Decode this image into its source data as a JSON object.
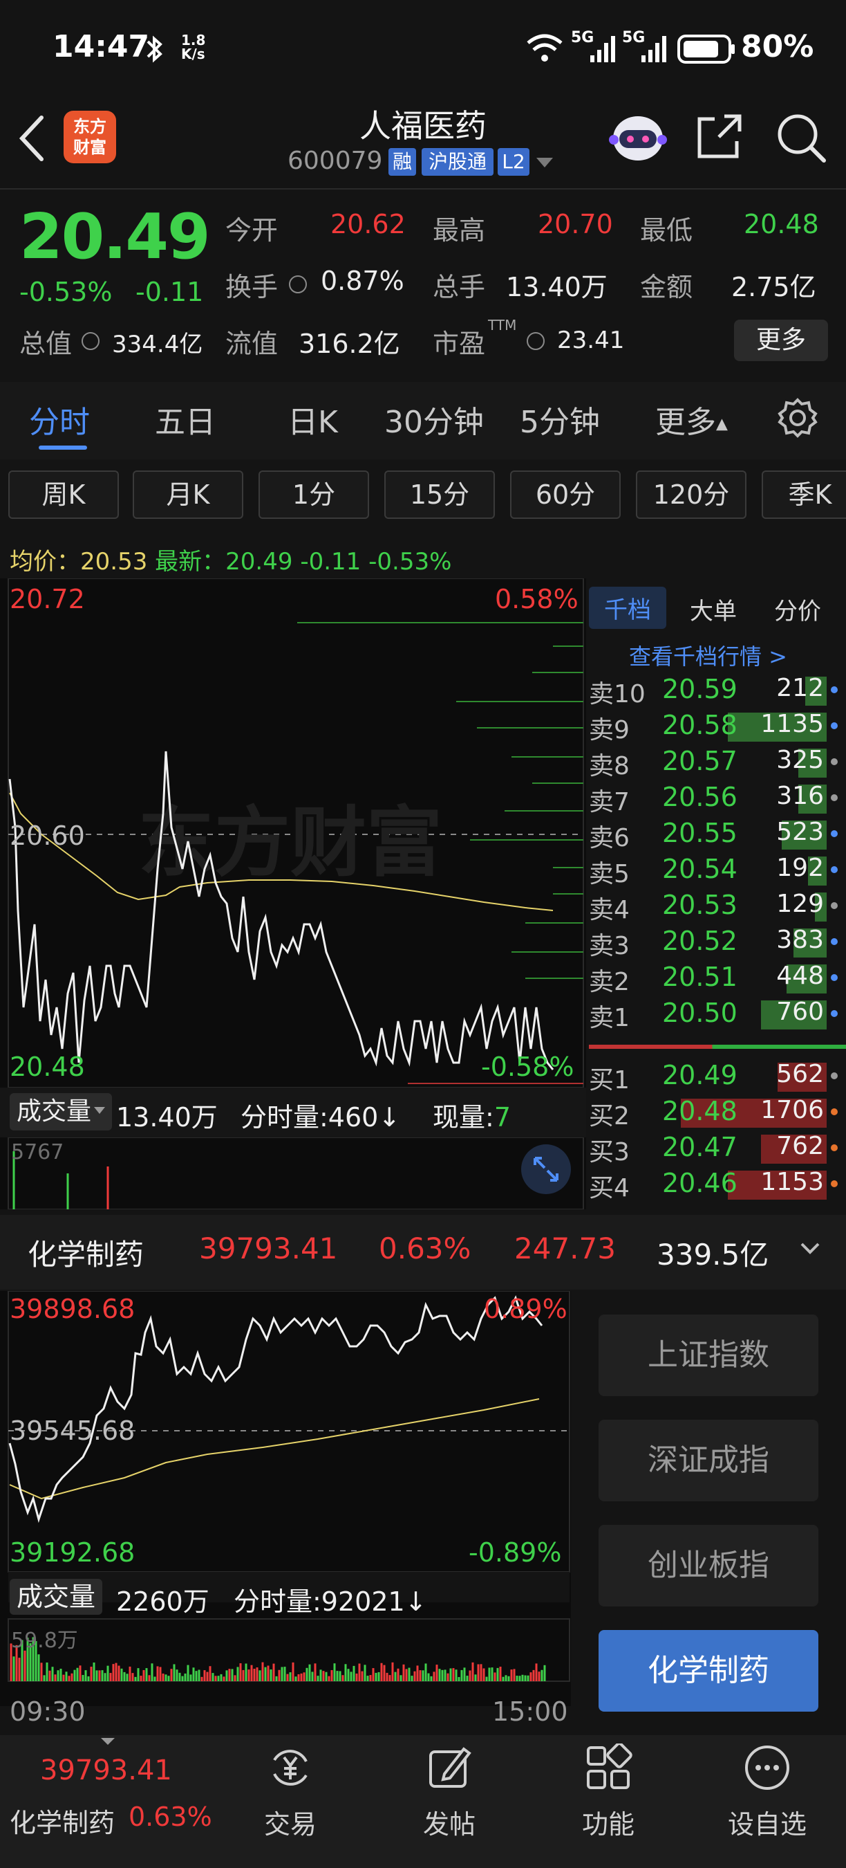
{
  "status_bar": {
    "time": "14:47",
    "speed_value": "1.8",
    "speed_unit": "K/s",
    "network_label": "5G",
    "battery": "80%"
  },
  "header": {
    "brand_line1": "东方",
    "brand_line2": "财富",
    "stock_name": "人福医药",
    "stock_code": "600079",
    "tag_rong": "融",
    "tag_hgt": "沪股通",
    "tag_l2": "L2"
  },
  "quote": {
    "price": "20.49",
    "change_pct": "-0.53%",
    "change": "-0.11",
    "open_label": "今开",
    "open": "20.62",
    "high_label": "最高",
    "high": "20.70",
    "low_label": "最低",
    "low": "20.48",
    "turnover_label": "换手",
    "turnover": "0.87%",
    "volume_label": "总手",
    "volume": "13.40万",
    "amount_label": "金额",
    "amount": "2.75亿",
    "mcap_label": "总值",
    "mcap": "334.4亿",
    "float_label": "流值",
    "float": "316.2亿",
    "pe_label": "市盈",
    "pe_sup": "TTM",
    "pe": "23.41",
    "more_label": "更多"
  },
  "tabs": [
    "分时",
    "五日",
    "日K",
    "30分钟",
    "5分钟",
    "更多"
  ],
  "periods": [
    "周K",
    "月K",
    "1分",
    "15分",
    "60分",
    "120分",
    "季K"
  ],
  "avg_line": {
    "avg_label": "均价：",
    "avg": "20.53",
    "latest_label": "最新：",
    "latest": "20.49",
    "chg": "-0.11",
    "pct": "-0.53%"
  },
  "chart1": {
    "y_max": "20.72",
    "y_mid": "20.60",
    "y_min": "20.48",
    "pct_max": "0.58%",
    "pct_min": "-0.58%",
    "watermark": "东方财富",
    "vol_axis": "5767"
  },
  "order_book": {
    "tabs": [
      "千档",
      "大单",
      "分价"
    ],
    "link": "查看千档行情 >",
    "sell": [
      {
        "label": "卖10",
        "price": "20.59",
        "vol": "212",
        "bar": 0.09
      },
      {
        "label": "卖9",
        "price": "20.58",
        "vol": "1135",
        "bar": 0.42
      },
      {
        "label": "卖8",
        "price": "20.57",
        "vol": "325",
        "bar": 0.12
      },
      {
        "label": "卖7",
        "price": "20.56",
        "vol": "316",
        "bar": 0.12
      },
      {
        "label": "卖6",
        "price": "20.55",
        "vol": "523",
        "bar": 0.19
      },
      {
        "label": "卖5",
        "price": "20.54",
        "vol": "192",
        "bar": 0.08
      },
      {
        "label": "卖4",
        "price": "20.53",
        "vol": "129",
        "bar": 0.05
      },
      {
        "label": "卖3",
        "price": "20.52",
        "vol": "383",
        "bar": 0.14
      },
      {
        "label": "卖2",
        "price": "20.51",
        "vol": "448",
        "bar": 0.17
      },
      {
        "label": "卖1",
        "price": "20.50",
        "vol": "760",
        "bar": 0.28
      }
    ],
    "buy": [
      {
        "label": "买1",
        "price": "20.49",
        "vol": "562",
        "bar": 0.21
      },
      {
        "label": "买2",
        "price": "20.48",
        "vol": "1706",
        "bar": 0.62
      },
      {
        "label": "买3",
        "price": "20.47",
        "vol": "762",
        "bar": 0.28
      },
      {
        "label": "买4",
        "price": "20.46",
        "vol": "1153",
        "bar": 0.42
      }
    ]
  },
  "volume_bar": {
    "dropdown_label": "成交量",
    "total": "13.40万",
    "minute": "分时量:460↓",
    "now_label": "现量:",
    "now": "7"
  },
  "sector": {
    "name": "化学制药",
    "index": "39793.41",
    "pct": "0.63%",
    "chg": "247.73",
    "amount": "339.5亿"
  },
  "chart2": {
    "y_max": "39898.68",
    "y_mid": "39545.68",
    "y_min": "39192.68",
    "pct_max": "0.89%",
    "pct_min": "-0.89%",
    "vol_label": "成交量",
    "vol_total": "2260万",
    "vol_minute": "分时量:92021↓",
    "vol_axis": "59.8万",
    "time_start": "09:30",
    "time_end": "15:00"
  },
  "index_buttons": [
    "上证指数",
    "深证成指",
    "创业板指",
    "化学制药"
  ],
  "bottom_nav": {
    "index_value": "39793.41",
    "index_name": "化学制药",
    "index_pct": "0.63%",
    "items": [
      "交易",
      "发帖",
      "功能",
      "设自选"
    ]
  },
  "colors": {
    "up": "#f03a3a",
    "down": "#3fd14b",
    "accent": "#4f8ef7",
    "avg": "#e6d36a"
  }
}
